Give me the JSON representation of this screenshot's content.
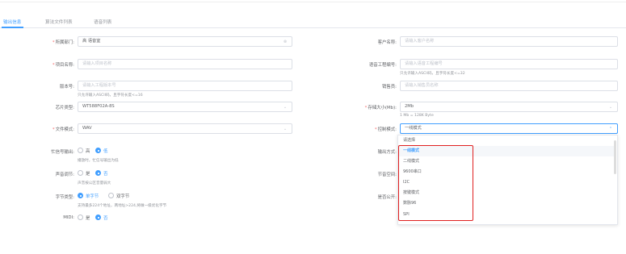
{
  "tabs": [
    "输出信息",
    "算法文件列表",
    "语音列表"
  ],
  "form": {
    "dept": {
      "label": "所属部门:",
      "value": "高 语音室"
    },
    "customer": {
      "label": "客户名称:",
      "placeholder": "请输入客户名称"
    },
    "project": {
      "label": "项目名称:",
      "placeholder": "请输入项目名称"
    },
    "voice_project_no": {
      "label": "语音工程编号:",
      "placeholder": "请输入语音工程编号",
      "hint": "只允许输入ASCII码，且字符长度<=32"
    },
    "version": {
      "label": "版本号:",
      "placeholder": "请输入工程版本号",
      "hint": "只允许输入ASCII码，且字符长度<=16"
    },
    "sales": {
      "label": "销售员:",
      "placeholder": "请输入销售员名称"
    },
    "chip": {
      "label": "芯片类型:",
      "value": "WT588F02A-8S"
    },
    "storage": {
      "label": "存储大小(Mb):",
      "value": "2Mb",
      "hint": "1 Mb = 128K Byte"
    },
    "file_mode": {
      "label": "文件模式:",
      "value": "WAV"
    },
    "control_mode": {
      "label": "控制模式:",
      "value": "一线模式"
    },
    "busy": {
      "label": "忙信号输出:",
      "options": [
        "高",
        "低"
      ],
      "selected": "低",
      "hint": "播放时，忙信号输出为低"
    },
    "output_mode": {
      "label": "输出方式:"
    },
    "volume": {
      "label": "声音调节:",
      "options": [
        "是",
        "否"
      ],
      "selected": "否",
      "hint": "声音按公区音量弱大"
    },
    "tone": {
      "label": "节音空间:"
    },
    "byte_type": {
      "label": "字节类型:",
      "options": [
        "单字节",
        "双字节"
      ],
      "selected": "单字节",
      "hint": "支持最多224个地址，两地址>224,将做一级优化字节"
    },
    "is_public": {
      "label": "是否公开:"
    },
    "midi": {
      "label": "MIDI:",
      "options": [
        "是",
        "否"
      ],
      "selected": "否"
    }
  },
  "dropdown": {
    "options": [
      "请选择",
      "一线模式",
      "二线模式",
      "9600串口",
      "I2C",
      "按键模式",
      "数脉96",
      "SPI"
    ],
    "selected": "一线模式"
  }
}
